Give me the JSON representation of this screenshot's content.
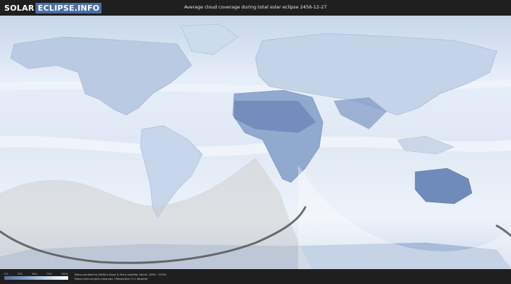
{
  "logo": {
    "part1": "SOLAR",
    "part2": "ECLIPSE.INFO"
  },
  "title": "Average cloud coverage during total solar eclipse 2456-12-27",
  "scale": {
    "ticks": [
      "0%",
      "25%",
      "50%",
      "75%",
      "100%"
    ]
  },
  "credits": {
    "line1": "Data provided by NASA's Aqua & Terra satellite (Years: 2000 - 2019)",
    "line2": "https://neo.sci.gsfc.nasa.gov | Resolution: 0.1 degrees"
  },
  "colors": {
    "background": "#1f1f1f",
    "ocean_light": "#e9f0f8",
    "cloudless": "#5473a8",
    "eclipse_path": "#555555"
  }
}
